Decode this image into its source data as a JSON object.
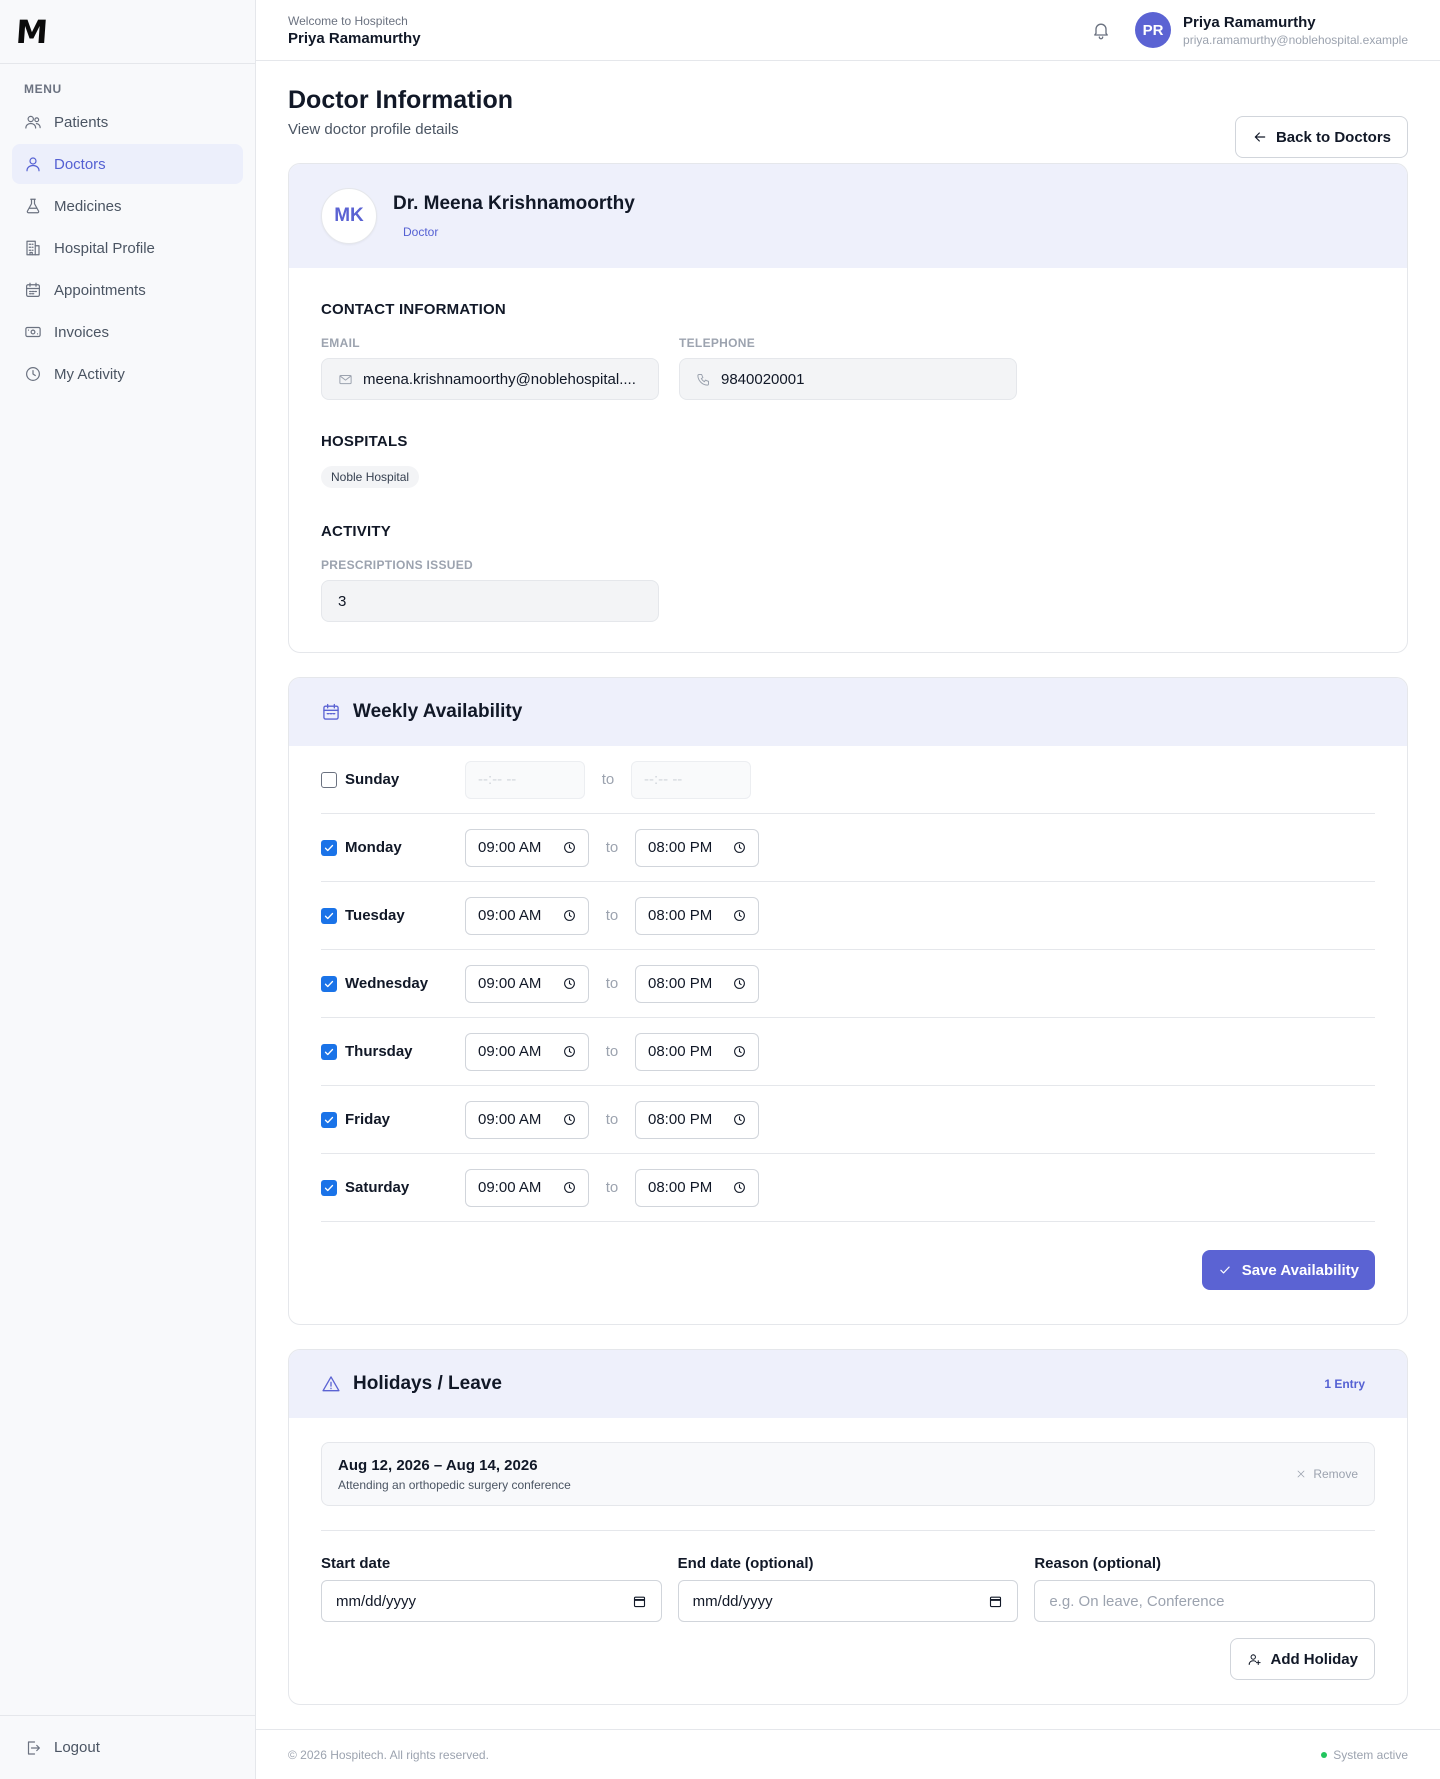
{
  "brand": {
    "logo_text": "M"
  },
  "sidebar": {
    "menu_title": "MENU",
    "items": [
      {
        "label": "Patients",
        "icon": "users-icon"
      },
      {
        "label": "Doctors",
        "icon": "user-icon",
        "active": true
      },
      {
        "label": "Medicines",
        "icon": "flask-icon"
      },
      {
        "label": "Hospital Profile",
        "icon": "building-icon"
      },
      {
        "label": "Appointments",
        "icon": "calendar-icon"
      },
      {
        "label": "Invoices",
        "icon": "banknote-icon"
      },
      {
        "label": "My Activity",
        "icon": "clock-icon"
      }
    ],
    "logout_label": "Logout"
  },
  "header": {
    "welcome": "Welcome to Hospitech",
    "welcome_name": "Priya Ramamurthy",
    "avatar_initials": "PR",
    "user_name": "Priya Ramamurthy",
    "user_email": "priya.ramamurthy@noblehospital.example"
  },
  "page": {
    "title": "Doctor Information",
    "subtitle": "View doctor profile details",
    "back_button": "Back to Doctors"
  },
  "doctor": {
    "initials": "MK",
    "name": "Dr. Meena Krishnamoorthy",
    "role": "Doctor",
    "contact_title": "CONTACT INFORMATION",
    "email_label": "EMAIL",
    "email": "meena.krishnamoorthy@noblehospital....",
    "telephone_label": "TELEPHONE",
    "telephone": "9840020001",
    "hospitals_title": "HOSPITALS",
    "hospitals": [
      "Noble Hospital"
    ],
    "activity_title": "ACTIVITY",
    "prescriptions_label": "PRESCRIPTIONS ISSUED",
    "prescriptions": "3"
  },
  "availability": {
    "title": "Weekly Availability",
    "to_label": "to",
    "empty_time": "--:-- --",
    "days": [
      {
        "name": "Sunday",
        "enabled": false,
        "start": "",
        "end": ""
      },
      {
        "name": "Monday",
        "enabled": true,
        "start": "09:00 AM",
        "end": "08:00 PM"
      },
      {
        "name": "Tuesday",
        "enabled": true,
        "start": "09:00 AM",
        "end": "08:00 PM"
      },
      {
        "name": "Wednesday",
        "enabled": true,
        "start": "09:00 AM",
        "end": "08:00 PM"
      },
      {
        "name": "Thursday",
        "enabled": true,
        "start": "09:00 AM",
        "end": "08:00 PM"
      },
      {
        "name": "Friday",
        "enabled": true,
        "start": "09:00 AM",
        "end": "08:00 PM"
      },
      {
        "name": "Saturday",
        "enabled": true,
        "start": "09:00 AM",
        "end": "08:00 PM"
      }
    ],
    "save_button": "Save Availability"
  },
  "holidays": {
    "title": "Holidays / Leave",
    "count": "1 Entry",
    "entries": [
      {
        "dates": "Aug 12, 2026 – Aug 14, 2026",
        "reason": "Attending an orthopedic surgery conference",
        "remove_label": "Remove"
      }
    ],
    "form": {
      "start_label": "Start date",
      "start_value": "mm/dd/yyyy",
      "end_label": "End date (optional)",
      "end_value": "mm/dd/yyyy",
      "reason_label": "Reason (optional)",
      "reason_placeholder": "e.g. On leave, Conference"
    },
    "add_button": "Add Holiday"
  },
  "footer": {
    "copyright": "© 2026 Hospitech. All rights reserved.",
    "status": "System active"
  },
  "colors": {
    "accent": "#5b63d3",
    "status_active": "#22c55e",
    "checkbox": "#1a73e8"
  }
}
